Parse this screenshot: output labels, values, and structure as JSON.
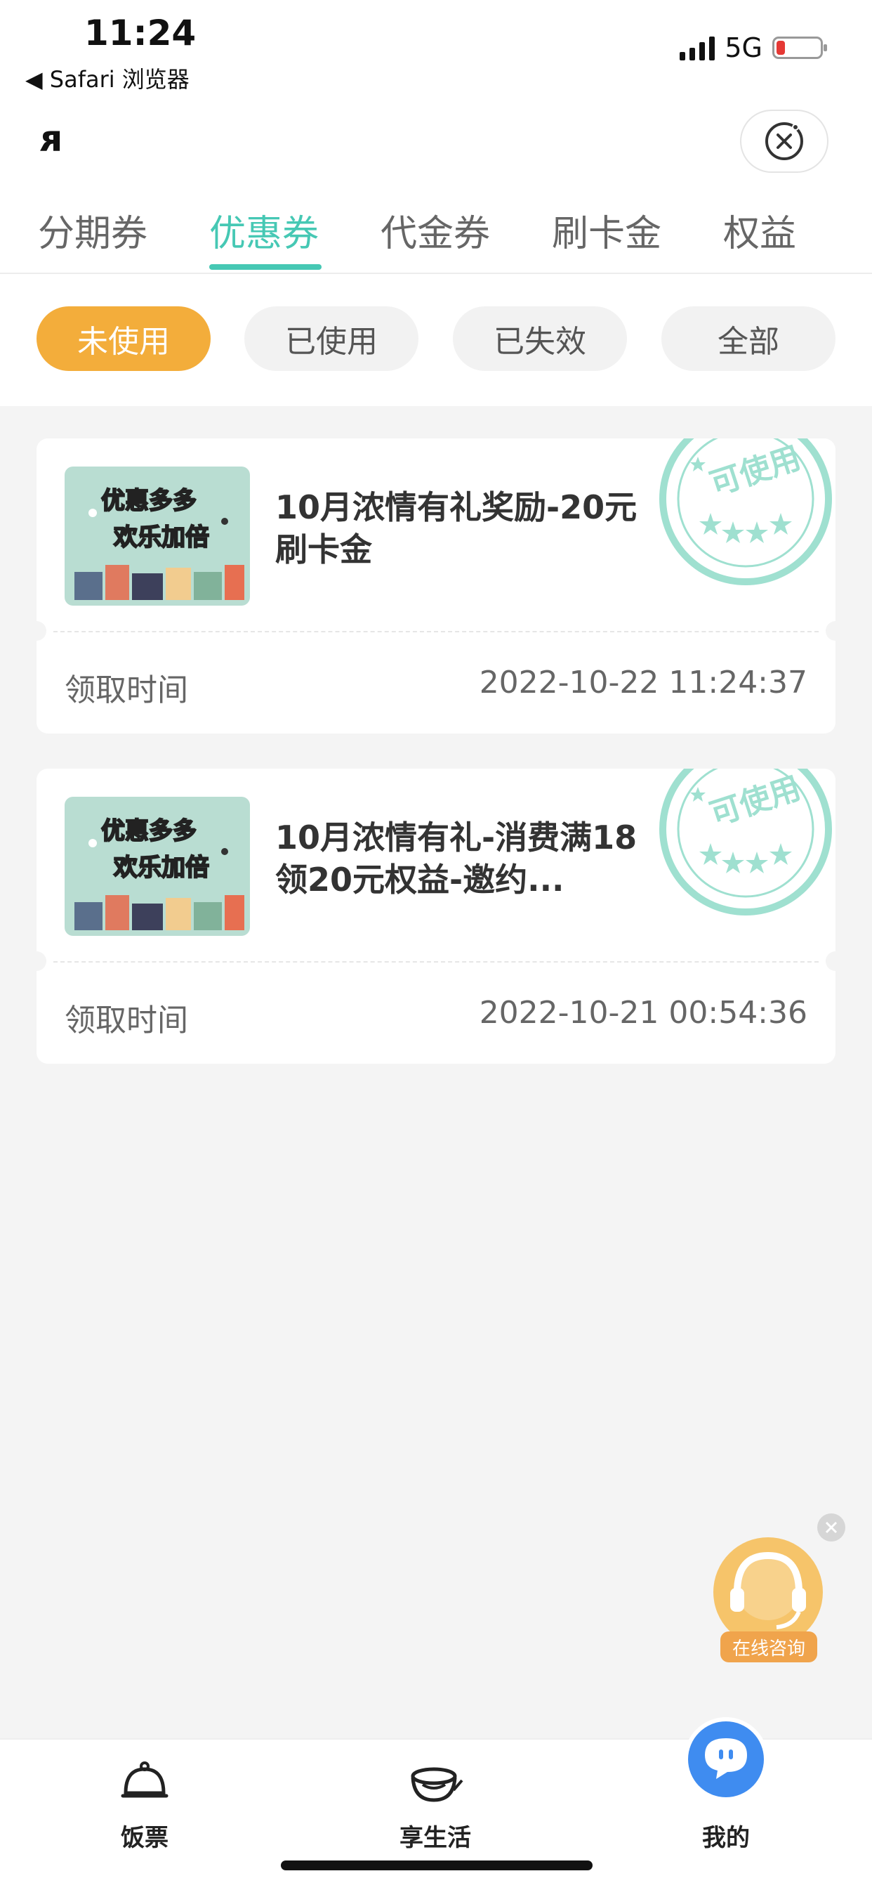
{
  "status_bar": {
    "time": "11:24",
    "back_label": "◀ Safari 浏览器",
    "network": "5G"
  },
  "nav": {
    "glyph": "ᴙ"
  },
  "tabs": [
    {
      "label": "分期券"
    },
    {
      "label": "优惠券"
    },
    {
      "label": "代金券"
    },
    {
      "label": "刷卡金"
    },
    {
      "label": "权益"
    }
  ],
  "active_tab": "优惠券",
  "filters": [
    {
      "label": "未使用"
    },
    {
      "label": "已使用"
    },
    {
      "label": "已失效"
    },
    {
      "label": "全部"
    }
  ],
  "active_filter": "未使用",
  "cards": [
    {
      "thumb_line1": "优惠多多",
      "thumb_line2": "欢乐加倍",
      "title": "10月浓情有礼奖励-20元刷卡金",
      "stamp": "可使用",
      "time_label": "领取时间",
      "time": "2022-10-22 11:24:37"
    },
    {
      "thumb_line1": "优惠多多",
      "thumb_line2": "欢乐加倍",
      "title": "10月浓情有礼-消费满18领20元权益-邀约...",
      "stamp": "可使用",
      "time_label": "领取时间",
      "time": "2022-10-21 00:54:36"
    }
  ],
  "floating_service": {
    "label": "在线咨询"
  },
  "bottom_nav": [
    {
      "label": "饭票",
      "icon": "rice-bowl-icon"
    },
    {
      "label": "享生活",
      "icon": "bowl-icon"
    },
    {
      "label": "我的",
      "icon": "chat-bubble-icon"
    }
  ],
  "colors": {
    "accent": "#46c8b4",
    "filter_active": "#f3ad3b",
    "stamp": "#9fe0d0"
  }
}
